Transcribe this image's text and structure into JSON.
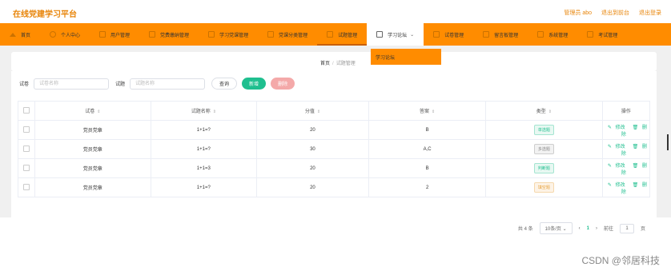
{
  "header": {
    "brand": "在线党建学习平台",
    "links": [
      "管理员 abo",
      "退出到前台",
      "退出登录"
    ]
  },
  "nav": {
    "items": [
      {
        "label": "首页",
        "icon": "home-icon"
      },
      {
        "label": "个人中心",
        "icon": "user-icon"
      },
      {
        "label": "用户管理",
        "icon": "users-icon"
      },
      {
        "label": "党费缴纳管理",
        "icon": "wallet-icon"
      },
      {
        "label": "学习党课管理",
        "icon": "book-icon"
      },
      {
        "label": "党课分类管理",
        "icon": "category-icon"
      },
      {
        "label": "试题管理",
        "icon": "exam-icon"
      },
      {
        "label": "学习论坛",
        "icon": "mail-icon"
      },
      {
        "label": "试卷管理",
        "icon": "paper-icon"
      },
      {
        "label": "留言板管理",
        "icon": "message-icon"
      },
      {
        "label": "系统管理",
        "icon": "settings-icon"
      },
      {
        "label": "考试管理",
        "icon": "test-icon"
      }
    ],
    "dropdown_item": "学习论坛"
  },
  "breadcrumb": {
    "home": "首页",
    "sep": "/",
    "current": "试题管理"
  },
  "search": {
    "label1": "试卷",
    "placeholder1": "试卷名称",
    "label2": "试题",
    "placeholder2": "试题名称",
    "query": "查询",
    "add": "新增",
    "delete": "删除"
  },
  "table": {
    "headers": [
      "试卷",
      "试题名称",
      "分值",
      "答案",
      "类型",
      "操作"
    ],
    "rows": [
      {
        "paper": "党员党章",
        "question": "1+1=?",
        "score": "20",
        "answer": "B",
        "type": "单选题",
        "type_color": "#1fbf8f",
        "type_bg": "#e8f8f2"
      },
      {
        "paper": "党员党章",
        "question": "1+1=?",
        "score": "30",
        "answer": "A,C",
        "type": "多选题",
        "type_color": "#888888",
        "type_bg": "#f2f2f2"
      },
      {
        "paper": "党员党章",
        "question": "1+1=3",
        "score": "20",
        "answer": "B",
        "type": "判断题",
        "type_color": "#1fbf8f",
        "type_bg": "#e8f8f2"
      },
      {
        "paper": "党员党章",
        "question": "1+1=?",
        "score": "20",
        "answer": "2",
        "type": "填空题",
        "type_color": "#e6a23c",
        "type_bg": "#fdf3e6"
      }
    ],
    "op_edit": "修改",
    "op_delete": "删除"
  },
  "pager": {
    "total": "共 4 条",
    "size": "10条/页",
    "page": "1",
    "goto": "前往",
    "goto_value": "1",
    "unit": "页"
  },
  "watermark": "CSDN @邻居科技"
}
